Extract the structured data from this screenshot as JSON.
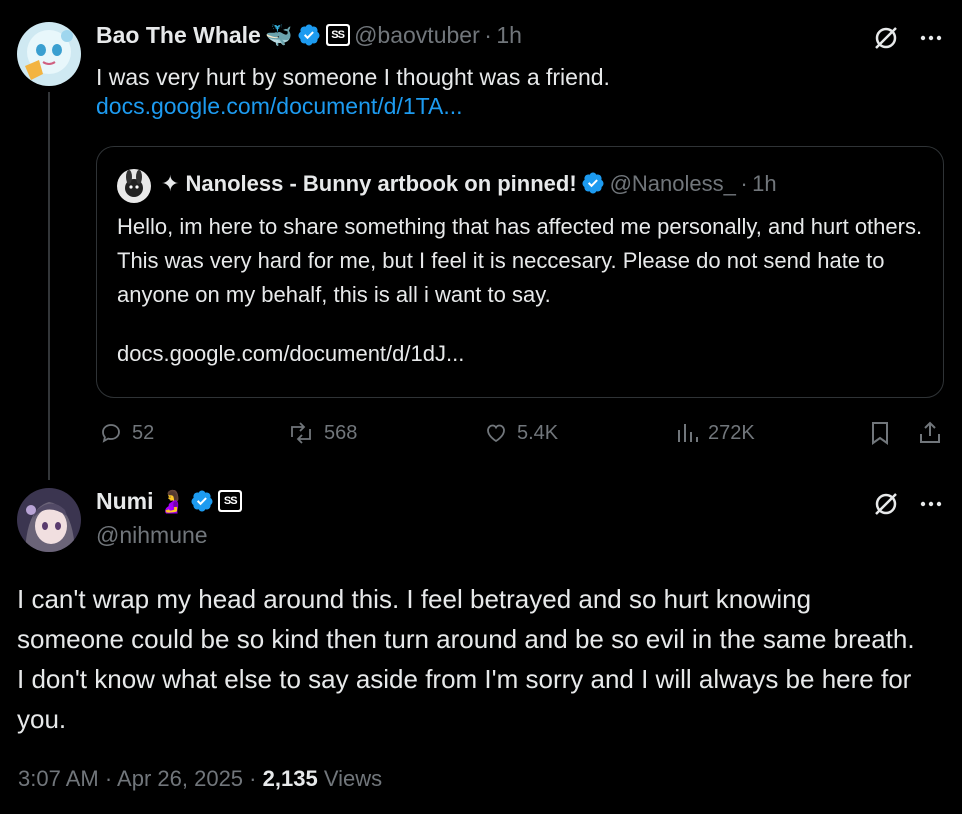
{
  "post1": {
    "display_name": "Bao The Whale",
    "name_emoji": "🐳",
    "handle": "@baovtuber",
    "separator": "·",
    "time": "1h",
    "text": "I was very hurt by someone I thought was a friend.",
    "link": "docs.google.com/document/d/1TA...",
    "quote": {
      "display_name": "✦ Nanoless - Bunny artbook on pinned!",
      "handle": "@Nanoless_",
      "separator": "·",
      "time": "1h",
      "text": "Hello, im here to share something that has affected me personally, and hurt others. This was very hard for me, but I feel it is neccesary. Please do not send hate to anyone on my behalf, this is all i want to say.",
      "link": "docs.google.com/document/d/1dJ..."
    },
    "actions": {
      "replies": "52",
      "reposts": "568",
      "likes": "5.4K",
      "views": "272K"
    }
  },
  "post2": {
    "display_name": "Numi",
    "name_emoji": "🤰",
    "handle": "@nihmune",
    "text": "I can't wrap my head around this. I feel betrayed and so hurt knowing someone could be so kind then turn around and be so evil in the same breath. I don't know what else to say aside from I'm sorry and I will always be here for you.",
    "timestamp": "3:07 AM · Apr 26, 2025",
    "separator": "·",
    "views_count": "2,135",
    "views_label": "Views"
  },
  "colors": {
    "background": "#000000",
    "text": "#e7e9ea",
    "muted": "#71767b",
    "link": "#1d9bf0",
    "verified": "#1d9bf0",
    "border": "#2f3336"
  }
}
